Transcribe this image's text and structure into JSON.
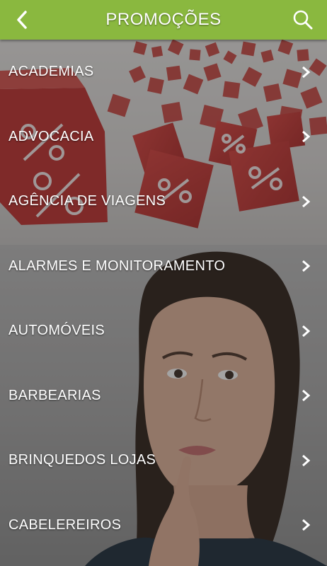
{
  "header": {
    "title": "PROMOÇÕES"
  },
  "icons": {
    "back": "chevron-left-icon",
    "search": "search-icon",
    "row": "chevron-right-icon"
  },
  "colors": {
    "header": "#8ab83f",
    "text": "#ffffff",
    "promo_cubes": "#c7312f"
  },
  "categories": [
    {
      "label": "ACADEMIAS"
    },
    {
      "label": "ADVOCACIA"
    },
    {
      "label": "AGÊNCIA DE VIAGENS"
    },
    {
      "label": "ALARMES E MONITORAMENTO"
    },
    {
      "label": "AUTOMÓVEIS"
    },
    {
      "label": "BARBEARIAS"
    },
    {
      "label": "BRINQUEDOS LOJAS"
    },
    {
      "label": "CABELEREIROS"
    }
  ]
}
